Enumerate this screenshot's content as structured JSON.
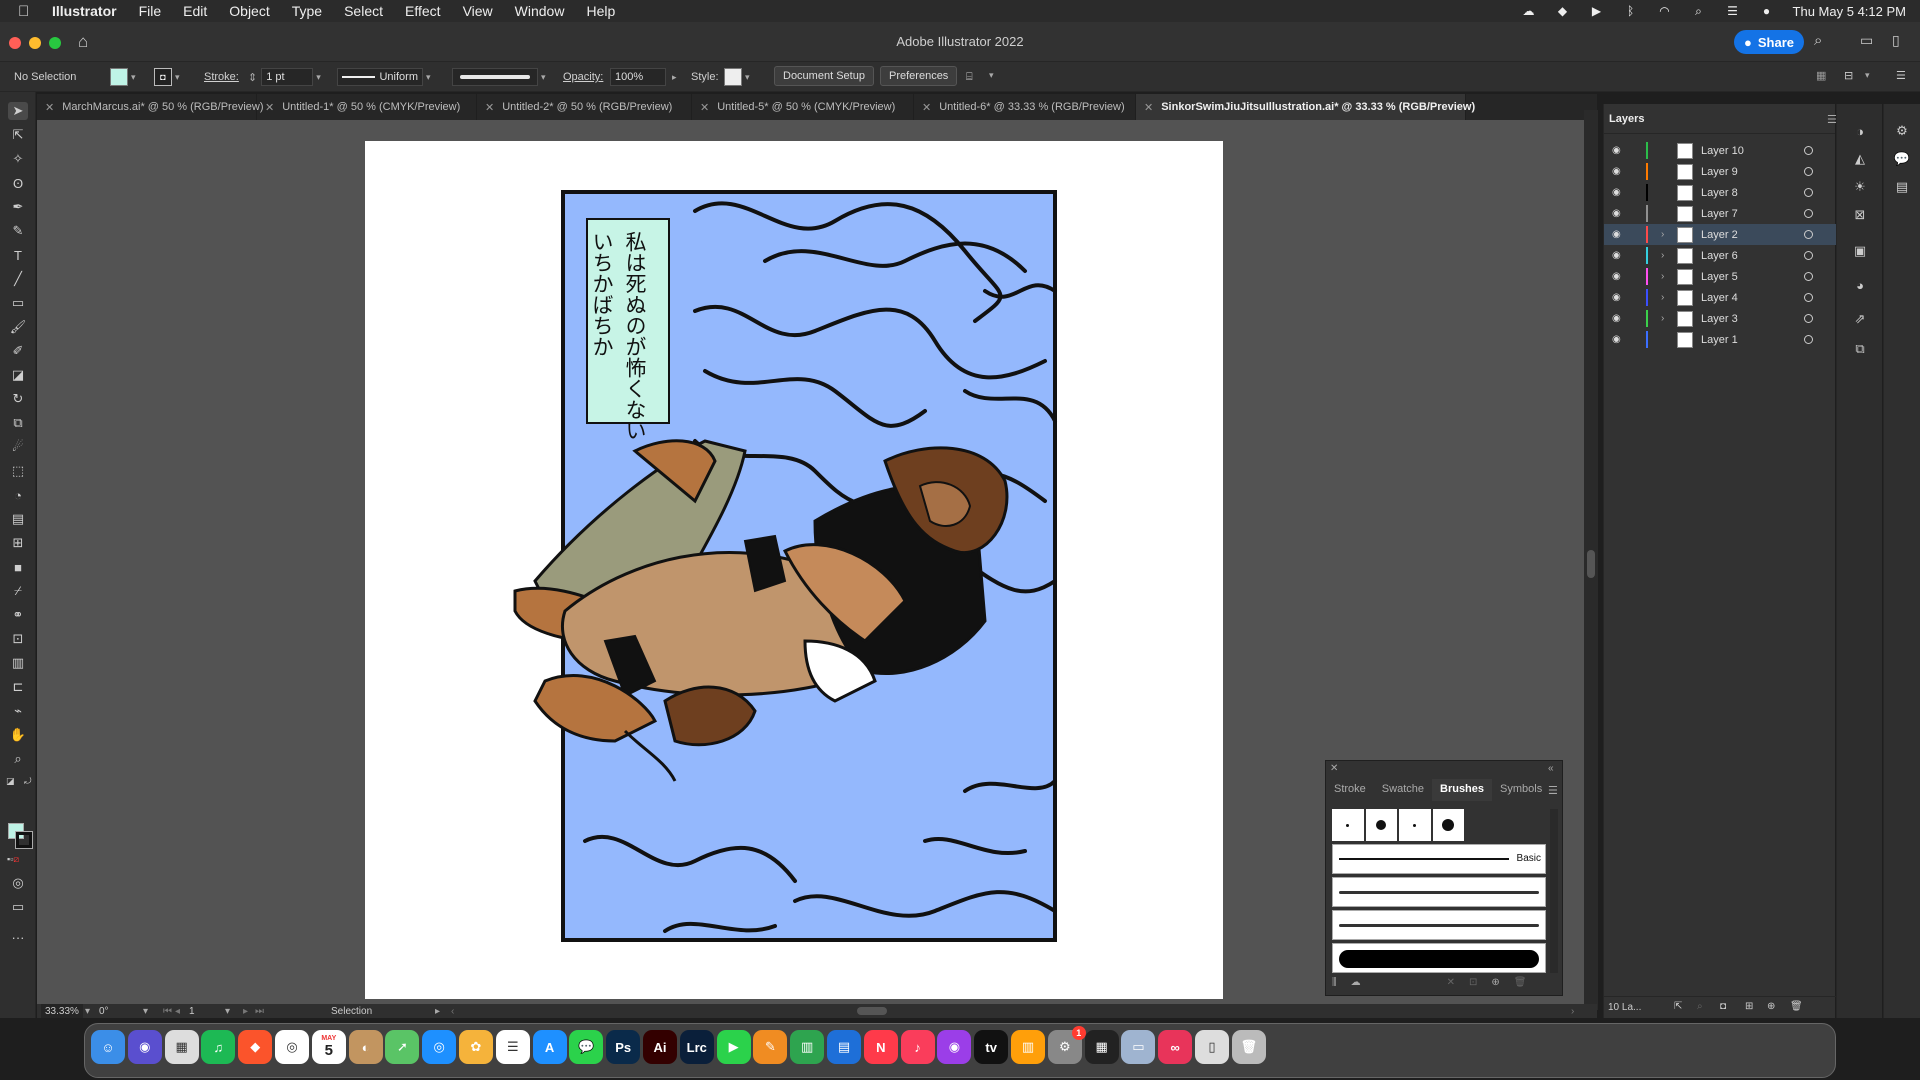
{
  "menubar": {
    "app": "Illustrator",
    "items": [
      "File",
      "Edit",
      "Object",
      "Type",
      "Select",
      "Effect",
      "View",
      "Window",
      "Help"
    ],
    "clock": "Thu May 5  4:12 PM"
  },
  "titlebar": {
    "title": "Adobe Illustrator 2022",
    "share_label": "Share"
  },
  "control": {
    "selection": "No Selection",
    "stroke_label": "Stroke:",
    "stroke_value": "1 pt",
    "profile": "Uniform",
    "opacity_label": "Opacity:",
    "opacity_value": "100%",
    "style_label": "Style:",
    "doc_setup": "Document Setup",
    "preferences": "Preferences",
    "fill_color": "#bff3e6"
  },
  "tabs": [
    "MarchMarcus.ai* @ 50 % (RGB/Preview)",
    "Untitled-1* @ 50 % (CMYK/Preview)",
    "Untitled-2* @ 50 % (RGB/Preview)",
    "Untitled-5* @ 50 % (CMYK/Preview)",
    "Untitled-6* @ 33.33 % (RGB/Preview)",
    "SinkorSwimJiuJitsuIllustration.ai* @ 33.33 % (RGB/Preview)"
  ],
  "artwork": {
    "caption_col1": "私は死ぬのが怖くない",
    "caption_col2": "いちかばちか",
    "bg_color": "#94b8fd",
    "caption_bg": "#c7f4e6"
  },
  "status": {
    "zoom": "33.33%",
    "rotation": "0°",
    "artboard": "1",
    "tool": "Selection"
  },
  "layers_panel": {
    "title": "Layers",
    "footer": "10 La...",
    "layers": [
      {
        "name": "Layer 10",
        "color": "#2bbd4a",
        "expandable": false,
        "selected": false
      },
      {
        "name": "Layer 9",
        "color": "#ff7b00",
        "expandable": false,
        "selected": false
      },
      {
        "name": "Layer 8",
        "color": "#000000",
        "expandable": false,
        "selected": false
      },
      {
        "name": "Layer 7",
        "color": "#909090",
        "expandable": false,
        "selected": false
      },
      {
        "name": "Layer 2",
        "color": "#ff4a4a",
        "expandable": true,
        "selected": true
      },
      {
        "name": "Layer 6",
        "color": "#34d0e0",
        "expandable": true,
        "selected": false
      },
      {
        "name": "Layer 5",
        "color": "#ff4ff0",
        "expandable": true,
        "selected": false
      },
      {
        "name": "Layer 4",
        "color": "#3b4fff",
        "expandable": true,
        "selected": false
      },
      {
        "name": "Layer 3",
        "color": "#3bd14b",
        "expandable": true,
        "selected": false
      },
      {
        "name": "Layer 1",
        "color": "#3b6fff",
        "expandable": false,
        "selected": false
      }
    ]
  },
  "brushes_panel": {
    "tabs": [
      "Stroke",
      "Swatche",
      "Brushes",
      "Symbols"
    ],
    "active_tab": "Brushes",
    "basic_label": "Basic"
  },
  "dock": {
    "apps": [
      "Finder",
      "Siri",
      "Launchpad",
      "Spotify",
      "Brave",
      "Chrome",
      "Calendar",
      "Contacts",
      "Maps",
      "Safari",
      "Photos",
      "Reminders",
      "App Store",
      "Messages",
      "Ps",
      "Ai",
      "Lrc",
      "FaceTime",
      "Pages",
      "Numbers",
      "Keynote",
      "News",
      "Music",
      "Podcasts",
      "tv",
      "Books",
      "System Preferences",
      "Activity Monitor",
      "Preview",
      "Creative Cloud",
      "Files",
      "Trash"
    ],
    "calendar_month": "MAY",
    "calendar_day": "5",
    "badge": "1"
  }
}
